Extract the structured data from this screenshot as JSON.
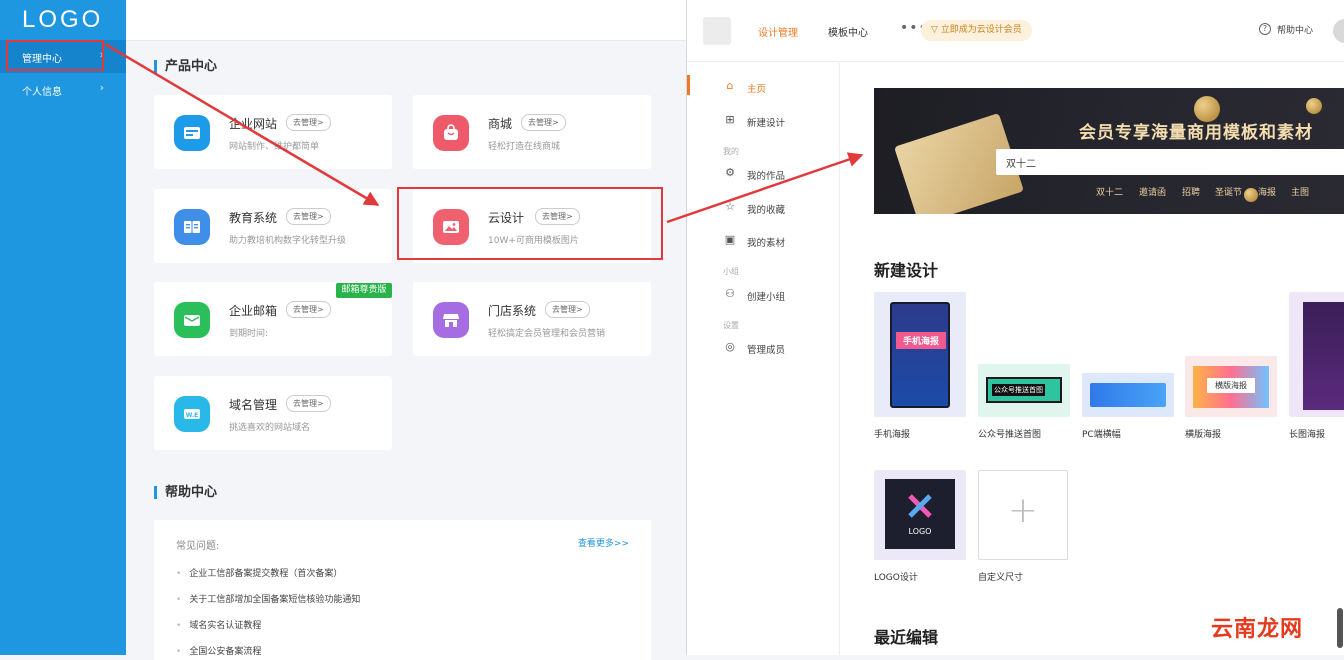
{
  "sidebar": {
    "logo": "LOGO",
    "items": [
      {
        "label": "管理中心"
      },
      {
        "label": "个人信息"
      }
    ]
  },
  "product_center": {
    "title": "产品中心",
    "cards": [
      {
        "name": "企业网站",
        "manage": "去管理>",
        "desc": "网站制作、维护都简单",
        "color": "#1e9be8"
      },
      {
        "name": "商城",
        "manage": "去管理>",
        "desc": "轻松打造在线商城",
        "color": "#ef5a6b"
      },
      {
        "name": "教育系统",
        "manage": "去管理>",
        "desc": "助力教培机构数字化转型升级",
        "color": "#3f8ee8"
      },
      {
        "name": "云设计",
        "manage": "去管理>",
        "desc": "10W+可商用模板图片",
        "color": "#f0616f"
      },
      {
        "name": "企业邮箱",
        "manage": "去管理>",
        "desc": "到期时间:",
        "color": "#2bbf5a",
        "badge": "邮箱尊贵版"
      },
      {
        "name": "门店系统",
        "manage": "去管理>",
        "desc": "轻松搞定会员管理和会员营销",
        "color": "#a66de3"
      },
      {
        "name": "域名管理",
        "manage": "去管理>",
        "desc": "挑选喜欢的网站域名",
        "color": "#29b9e8"
      }
    ]
  },
  "help_center": {
    "title": "帮助中心",
    "faq_title": "常见问题:",
    "more": "查看更多>>",
    "items": [
      "企业工信部备案提交教程（首次备案）",
      "关于工信部增加全国备案短信核验功能通知",
      "域名实名认证教程",
      "全国公安备案流程"
    ]
  },
  "design_panel": {
    "nav": {
      "design_manage": "设计管理",
      "template_center": "模板中心",
      "more": "•••",
      "vip": "立即成为云设计会员",
      "help": "帮助中心"
    },
    "side": {
      "home": "主页",
      "new_design": "新建设计",
      "group_mine": "我的",
      "my_works": "我的作品",
      "my_favorites": "我的收藏",
      "my_materials": "我的素材",
      "group_team": "小组",
      "create_group": "创建小组",
      "group_settings": "设置",
      "manage_members": "管理成员"
    },
    "banner": {
      "title": "会员专享海量商用模板和素材",
      "search_value": "双十二",
      "tags": [
        "双十二",
        "邀请函",
        "招聘",
        "圣诞节",
        "海报",
        "主图"
      ]
    },
    "new_design": {
      "title": "新建设计",
      "templates": [
        {
          "label": "手机海报",
          "thumb_text": "手机海报"
        },
        {
          "label": "公众号推送首图",
          "thumb_text": "公众号推送首图"
        },
        {
          "label": "PC端横幅",
          "thumb_text": ""
        },
        {
          "label": "横版海报",
          "thumb_text": "横版海报"
        },
        {
          "label": "长图海报",
          "thumb_text": ""
        },
        {
          "label": "LOGO设计",
          "thumb_text": "LOGO"
        },
        {
          "label": "自定义尺寸",
          "thumb_text": "+"
        }
      ]
    },
    "recent_title": "最近编辑"
  },
  "watermark": "云南龙网",
  "colors": {
    "sidebar": "#1e96e0",
    "accent_orange": "#ee7a25",
    "annotation_red": "#e23a3a",
    "banner_gold": "#f3dcae"
  }
}
